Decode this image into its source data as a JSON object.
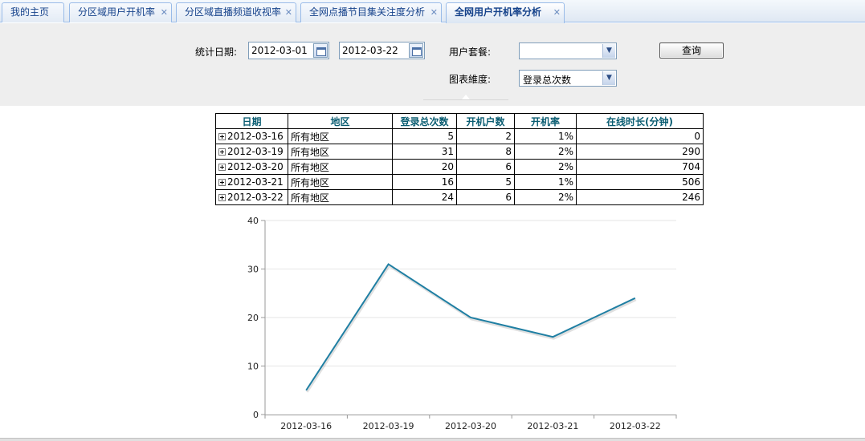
{
  "tabs": [
    {
      "label": "我的主页",
      "active": false,
      "closable": false
    },
    {
      "label": "分区域用户开机率",
      "active": false,
      "closable": true
    },
    {
      "label": "分区域直播频道收视率",
      "active": false,
      "closable": true
    },
    {
      "label": "全网点播节目集关注度分析",
      "active": false,
      "closable": true
    },
    {
      "label": "全网用户开机率分析",
      "active": true,
      "closable": true
    }
  ],
  "query": {
    "date_label": "统计日期:",
    "start_date": "2012-03-01",
    "end_date": "2012-03-22",
    "package_label": "用户套餐:",
    "package_value": "",
    "dimension_label": "图表維度:",
    "dimension_value": "登录总次数",
    "query_button": "查询"
  },
  "table": {
    "headers": [
      "日期",
      "地区",
      "登录总次数",
      "开机户数",
      "开机率",
      "在线时长(分钟)"
    ],
    "rows": [
      {
        "date": "2012-03-16",
        "region": "所有地区",
        "logins": "5",
        "households": "2",
        "rate": "1%",
        "online": "0"
      },
      {
        "date": "2012-03-19",
        "region": "所有地区",
        "logins": "31",
        "households": "8",
        "rate": "2%",
        "online": "290"
      },
      {
        "date": "2012-03-20",
        "region": "所有地区",
        "logins": "20",
        "households": "6",
        "rate": "2%",
        "online": "704"
      },
      {
        "date": "2012-03-21",
        "region": "所有地区",
        "logins": "16",
        "households": "5",
        "rate": "1%",
        "online": "506"
      },
      {
        "date": "2012-03-22",
        "region": "所有地区",
        "logins": "24",
        "households": "6",
        "rate": "2%",
        "online": "246"
      }
    ]
  },
  "chart_data": {
    "type": "line",
    "categories": [
      "2012-03-16",
      "2012-03-19",
      "2012-03-20",
      "2012-03-21",
      "2012-03-22"
    ],
    "series": [
      {
        "values": [
          5,
          31,
          20,
          16,
          24
        ],
        "color": "#1f7fa3"
      }
    ],
    "title": "",
    "xlabel": "",
    "ylabel": "",
    "ylim": [
      0,
      40
    ],
    "yticks": [
      "0",
      "10",
      "20",
      "30",
      "40"
    ],
    "grid": true,
    "legend": "none"
  },
  "colors": {
    "tab_text": "#15428b",
    "header_text": "#0b5d72",
    "line": "#1f7fa3",
    "panel_bg": "#eeeeee"
  }
}
